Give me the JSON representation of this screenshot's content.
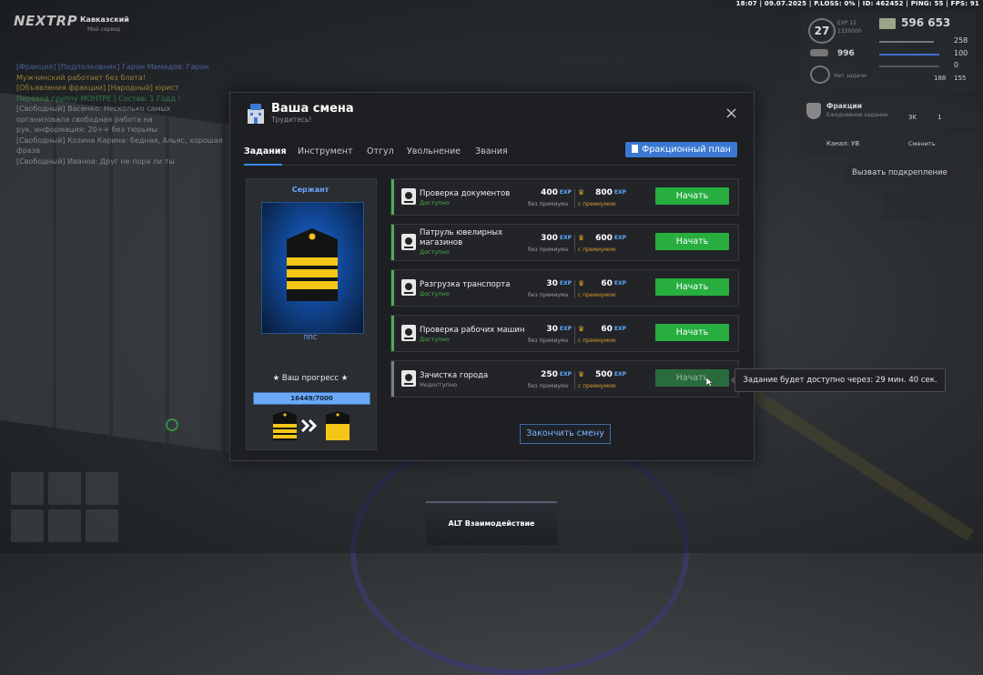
{
  "status_bar": "18:07 | 09.07.2025 | P.LOSS: 0% | ID: 462452 | PING: 55 | FPS: 91",
  "logo": {
    "text": "NEXTRP",
    "server": "Кавказский",
    "server_sub": "Мой сервер"
  },
  "chat": [
    {
      "text": "[Фракция] [Подполковник] Гарон Мамедов: Гарон",
      "color": "#6b8dff"
    },
    {
      "text": "Мужчинский работает без блата!",
      "color": "#f2c744"
    },
    {
      "text": "[Объявления фракции] [Народный] юрист",
      "color": "#f2c744"
    },
    {
      "text": "Перевод группу МОНТРЕ | Состав: 1 Годд !",
      "color": "#3fbf5f"
    },
    {
      "text": "[Свободный] Васенко: Несколько самых",
      "color": "#c9c9c9"
    },
    {
      "text": "организовала свободная работа на",
      "color": "#c9c9c9"
    },
    {
      "text": "рук. информация: 20++ без тюрьмы",
      "color": "#c9c9c9"
    },
    {
      "text": "[Свободный] Козина Карина: бедная, Альяс, хорошая",
      "color": "#c9c9c9"
    },
    {
      "text": "фраза",
      "color": "#c9c9c9"
    },
    {
      "text": "[Свободный] Иванов: Друг не пора ли ты",
      "color": "#c9c9c9"
    }
  ],
  "hud": {
    "level": "27",
    "exp_label": "EXP 12",
    "exp_value": "1320000",
    "money": "596 653",
    "bank": "996",
    "no_tasks": "Нет задачи",
    "health": "258",
    "armor": "100",
    "stat3": "0",
    "stat4": "188",
    "stat5": "155",
    "faction_title": "Фракции",
    "faction_sub": "Ежедневное задание",
    "faction_val1": "3K",
    "faction_val2": "1",
    "channel_label": "Канал: УВ",
    "channel_change": "Сменить",
    "backup_btn": "Вызвать подкрепление"
  },
  "modal": {
    "title": "Ваша смена",
    "subtitle": "Трудитесь!",
    "close_icon": "×",
    "tabs": [
      "Задания",
      "Инструмент",
      "Отгул",
      "Увольнение",
      "Звания"
    ],
    "active_tab": 0,
    "plan_button": "Фракционный план",
    "rank": {
      "name": "Сержант",
      "unit": "ППС",
      "progress_label": "★ Ваш прогресс ★",
      "progress_text": "16449/7000",
      "progress_fraction": 1.0
    },
    "no_premium_label": "без премиума",
    "premium_label": "с премиумом",
    "exp_tag": "EXP",
    "tasks": [
      {
        "name": "Проверка документов",
        "status": "Доступно",
        "available": true,
        "exp": "400",
        "exp_premium": "800",
        "button": "Начать",
        "icon": "passport-icon"
      },
      {
        "name": "Патруль ювелирных магазинов",
        "status": "Доступно",
        "available": true,
        "exp": "300",
        "exp_premium": "600",
        "button": "Начать",
        "icon": "jewel-icon"
      },
      {
        "name": "Разгрузка транспорта",
        "status": "Доступно",
        "available": true,
        "exp": "30",
        "exp_premium": "60",
        "button": "Начать",
        "icon": "truck-icon"
      },
      {
        "name": "Проверка рабочих машин",
        "status": "Доступно",
        "available": true,
        "exp": "30",
        "exp_premium": "60",
        "button": "Начать",
        "icon": "car-icon"
      },
      {
        "name": "Зачистка города",
        "status": "Недоступно",
        "available": false,
        "exp": "250",
        "exp_premium": "500",
        "button": "Начать",
        "icon": "cleanup-icon"
      }
    ],
    "end_shift_button": "Закончить смену"
  },
  "tooltip": "Задание будет доступно через: 29 мин. 40 сек.",
  "interaction_hint": "ALT Взаимодействие",
  "colors": {
    "accent_blue": "#3a78d4",
    "start_green": "#27ae3f",
    "available_green": "#4caf50",
    "rank_gold": "#f5c518"
  }
}
